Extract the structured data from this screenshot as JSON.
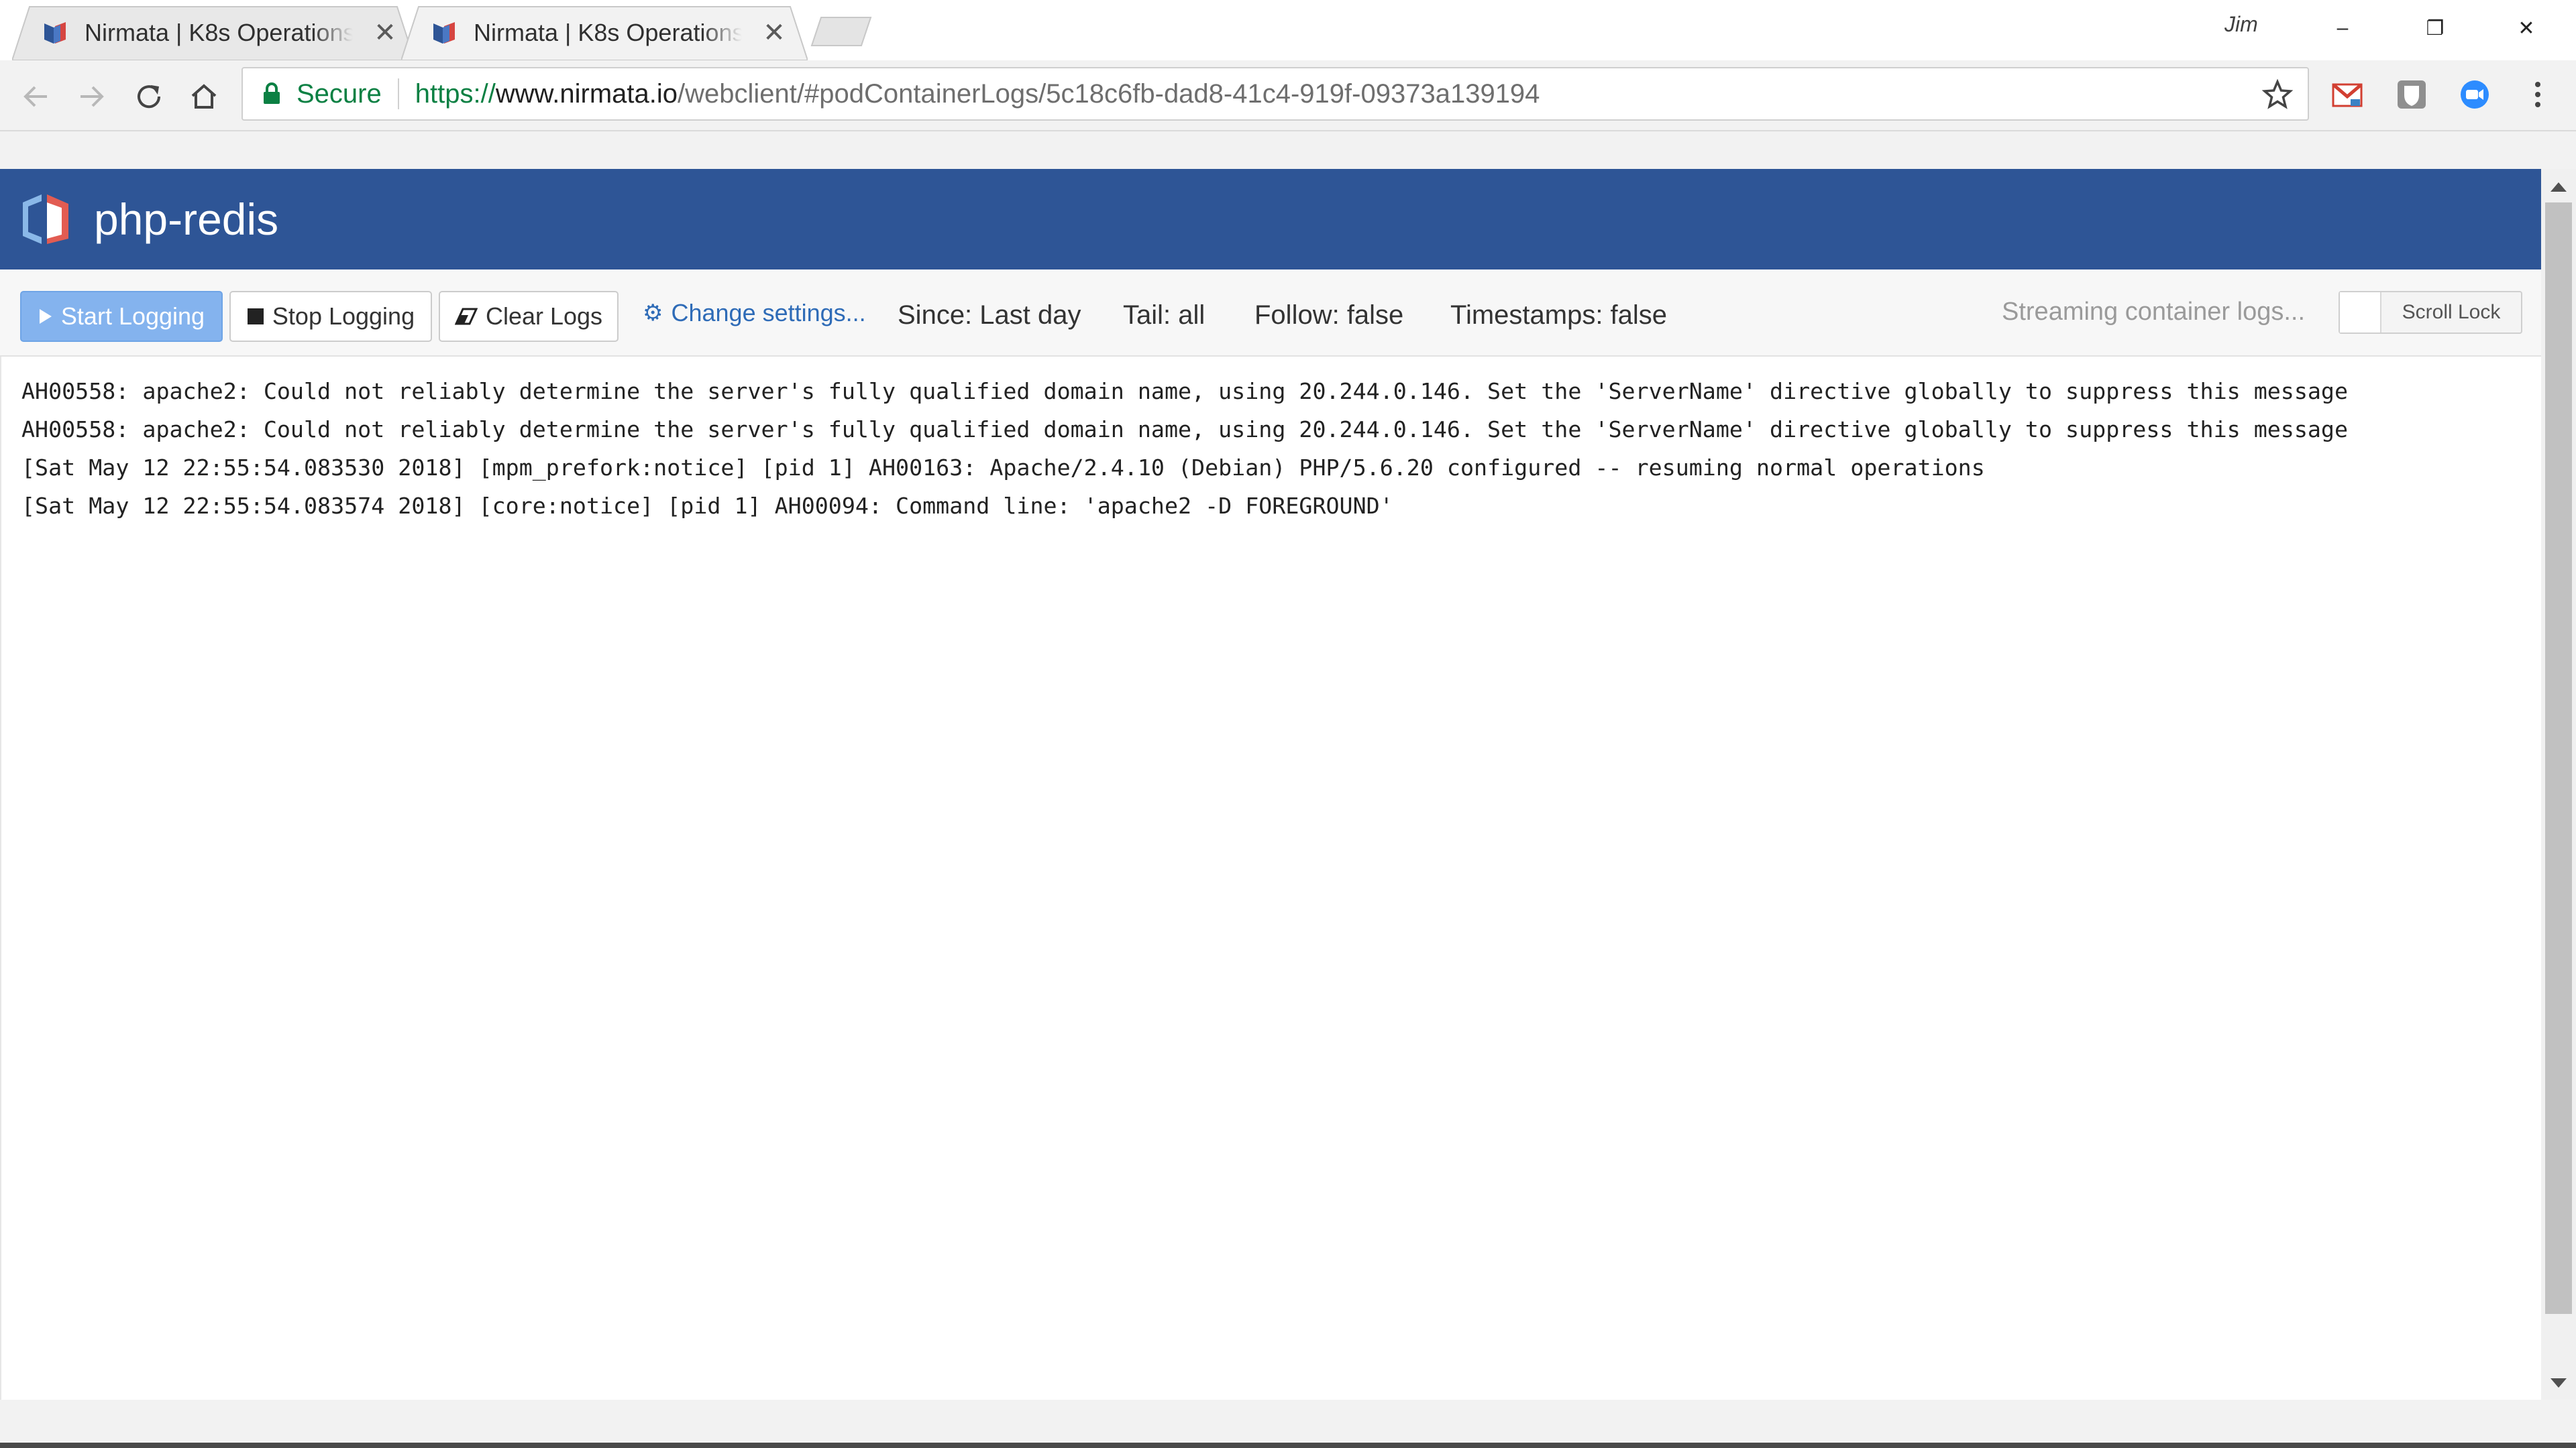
{
  "browser": {
    "tabs": [
      {
        "title": "Nirmata | K8s Operations",
        "active": false
      },
      {
        "title": "Nirmata | K8s Operations",
        "active": true
      }
    ],
    "profile_name": "Jim",
    "window_controls": {
      "minimize": "–",
      "restore": "❐",
      "close": "✕"
    },
    "address": {
      "security_label": "Secure",
      "url_scheme": "https://",
      "url_host": "www.nirmata.io",
      "url_path": "/webclient/#podContainerLogs/5c18c6fb-dad8-41c4-919f-09373a139194"
    },
    "extensions": [
      "gmail-icon",
      "extension-icon",
      "zoom-icon"
    ],
    "icons": {
      "back": "back-arrow-icon",
      "forward": "forward-arrow-icon",
      "reload": "reload-icon",
      "home": "home-icon",
      "star": "star-icon",
      "menu": "more-vert-icon"
    }
  },
  "app": {
    "title": "php-redis",
    "brand_color": "#2e5596",
    "controls": {
      "start_label": "Start Logging",
      "stop_label": "Stop Logging",
      "clear_label": "Clear Logs",
      "settings_label": "Change settings...",
      "since": "Since: Last day",
      "tail": "Tail: all",
      "follow": "Follow: false",
      "timestamps": "Timestamps: false",
      "streaming_status": "Streaming container logs...",
      "scroll_lock_label": "Scroll Lock"
    },
    "logs": [
      "AH00558: apache2: Could not reliably determine the server's fully qualified domain name, using 20.244.0.146. Set the 'ServerName' directive globally to suppress this message",
      "AH00558: apache2: Could not reliably determine the server's fully qualified domain name, using 20.244.0.146. Set the 'ServerName' directive globally to suppress this message",
      "[Sat May 12 22:55:54.083530 2018] [mpm_prefork:notice] [pid 1] AH00163: Apache/2.4.10 (Debian) PHP/5.6.20 configured -- resuming normal operations",
      "[Sat May 12 22:55:54.083574 2018] [core:notice] [pid 1] AH00094: Command line: 'apache2 -D FOREGROUND'"
    ]
  }
}
